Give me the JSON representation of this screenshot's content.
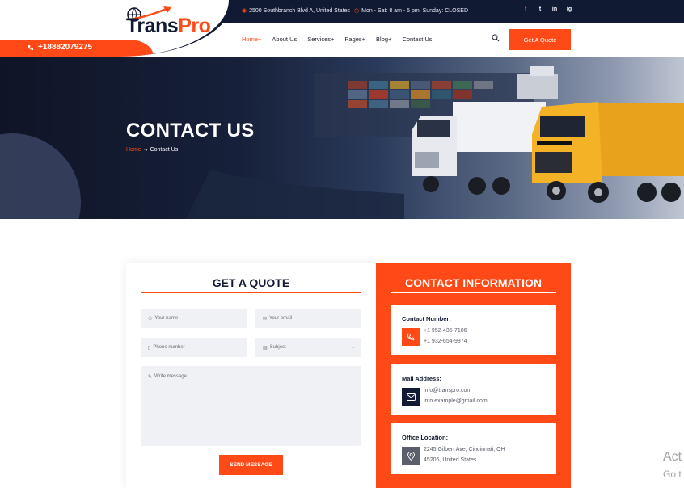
{
  "colors": {
    "accent": "#ff4a17",
    "navy": "#111a33"
  },
  "topbar": {
    "address": "2500 Southbranch Blvd A, United States",
    "hours": "Mon - Sat: 8 am - 5 pm, Sunday: CLOSED",
    "social": [
      "f",
      "t",
      "in",
      "ig"
    ]
  },
  "header": {
    "phone": "+18882079275",
    "logo_part1": "Trans",
    "logo_part2": "Pro",
    "nav": [
      "Home+",
      "About Us",
      "Services+",
      "Pages+",
      "Blog+",
      "Contact Us"
    ],
    "quote_button": "Get A Quote"
  },
  "hero": {
    "title": "CONTACT US",
    "crumb_home": "Home",
    "crumb_arrow": "→",
    "crumb_current": "Contact Us"
  },
  "form": {
    "title": "GET A QUOTE",
    "name_placeholder": "Your name",
    "email_placeholder": "Your email",
    "phone_placeholder": "Phone number",
    "subject_placeholder": "Subject",
    "message_placeholder": "Write message",
    "send_label": "SEND MESSAGE"
  },
  "contact": {
    "title": "CONTACT INFORMATION",
    "boxes": [
      {
        "label": "Contact Number:",
        "line1": "+1 952-435-7106",
        "line2": "+1 932-654-9874",
        "icon": "phone-icon"
      },
      {
        "label": "Mail Address:",
        "line1": "info@transpro.com",
        "line2": "info.example@gmail.com",
        "icon": "mail-icon"
      },
      {
        "label": "Office Location:",
        "line1": "2245 Gilbert Ave, Cincinnati, OH",
        "line2": "45206, United States",
        "icon": "location-icon"
      }
    ]
  },
  "overlay": {
    "line1": "Act",
    "line2": "Go t"
  }
}
